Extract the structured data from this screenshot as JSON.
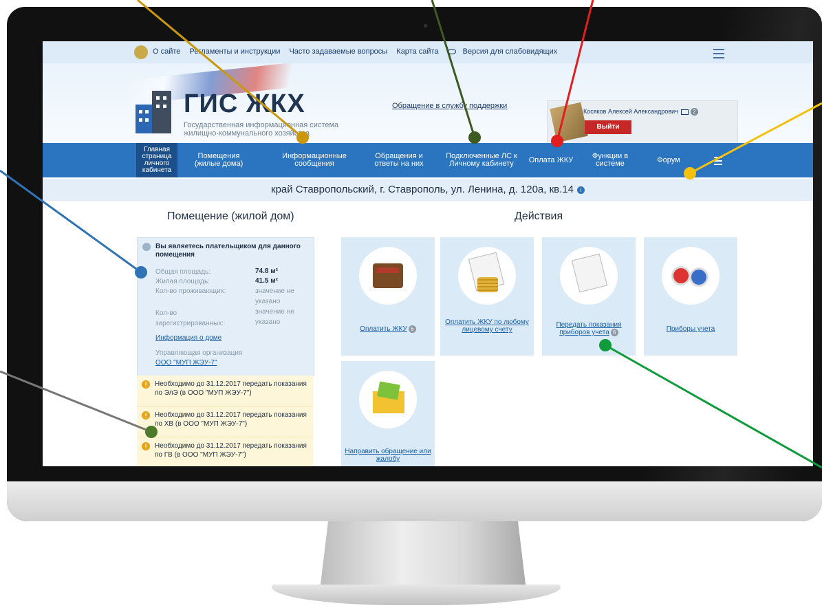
{
  "topbar": {
    "links": [
      "О сайте",
      "Регламенты и инструкции",
      "Часто задаваемые вопросы",
      "Карта сайта"
    ],
    "accessibility_label": "Версия для слабовидящих"
  },
  "header": {
    "logo_title": "ГИС ЖКХ",
    "logo_subtitle": "Государственная информационная система жилищно-коммунального хозяйства",
    "support_link": "Обращение в службу поддержки",
    "user_name": "Косяков Алексей Александрович",
    "notification_count": "2",
    "logout_label": "Выйти"
  },
  "nav": {
    "items": [
      "Главная страница личного кабинета",
      "Помещения (жилые дома)",
      "Информационные сообщения",
      "Обращения и ответы на них",
      "Подключенные ЛС к Личному кабинету",
      "Оплата ЖКУ",
      "Функции в системе",
      "Форум"
    ]
  },
  "address": "край Ставропольский, г. Ставрополь, ул. Ленина, д. 120а, кв.14",
  "left": {
    "heading": "Помещение (жилой дом)",
    "payer_note": "Вы являетесь плательщиком для данного помещения",
    "total_area_label": "Общая площадь:",
    "total_area_value": "74.8 м²",
    "living_area_label": "Жилая площадь:",
    "living_area_value": "41.5 м²",
    "residents_label": "Кол-во проживающих:",
    "residents_value": "значение не указано",
    "registered_label": "Кол-во зарегистрированных:",
    "registered_value": "значение не указано",
    "house_info_link": "Информация о доме",
    "mgmt_label": "Управляющая организация",
    "mgmt_link": "ООО \"МУП ЖЭУ-7\"",
    "notices": [
      "Необходимо до 31.12.2017 передать показания по ЭлЭ (в ООО \"МУП ЖЭУ-7\")",
      "Необходимо до 31.12.2017 передать показания по ХВ (в ООО \"МУП ЖЭУ-7\")",
      "Необходимо до 31.12.2017 передать показания по ГВ (в ООО \"МУП ЖЭУ-7\")"
    ]
  },
  "actions": {
    "heading": "Действия",
    "tiles": [
      {
        "label": "Оплатить ЖКУ",
        "badge": "6",
        "icon": "wallet-icon"
      },
      {
        "label": "Оплатить ЖКУ по любому лицевому счету",
        "icon": "coins-icon"
      },
      {
        "label": "Передать показания приборов учета",
        "badge": "6",
        "icon": "document-icon"
      },
      {
        "label": "Приборы учета",
        "icon": "water-meter-icon"
      },
      {
        "label": "Направить обращение или жалобу",
        "icon": "envelope-icon"
      }
    ]
  },
  "colors": {
    "nav_blue": "#2b74c0",
    "nav_active": "#1c4f8a",
    "logout_red": "#c62828",
    "tile_bg": "#dbeaf7",
    "notice_bg": "#fdf6d8"
  }
}
